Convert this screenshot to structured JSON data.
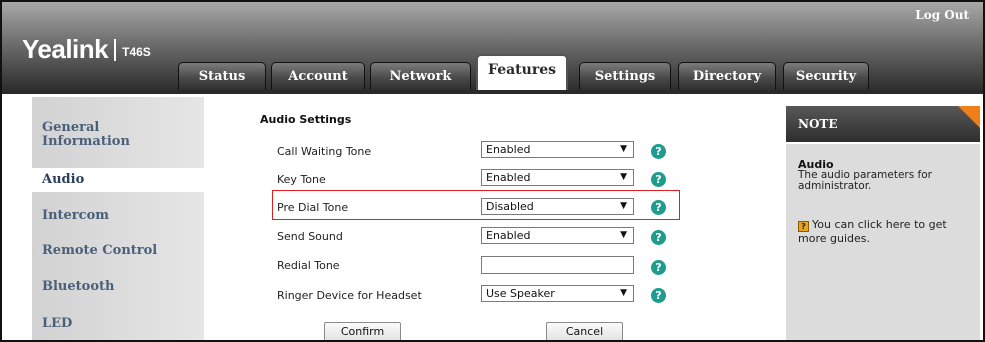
{
  "header": {
    "brand": "Yealink",
    "model": "T46S",
    "logout_label": "Log Out",
    "tabs": [
      {
        "label": "Status",
        "active": false
      },
      {
        "label": "Account",
        "active": false
      },
      {
        "label": "Network",
        "active": false
      },
      {
        "label": "Features",
        "active": true
      },
      {
        "label": "Settings",
        "active": false
      },
      {
        "label": "Directory",
        "active": false
      },
      {
        "label": "Security",
        "active": false
      }
    ]
  },
  "sidebar": {
    "items": [
      {
        "label": "General\nInformation",
        "active": false
      },
      {
        "label": "Audio",
        "active": true
      },
      {
        "label": "Intercom",
        "active": false
      },
      {
        "label": "Remote Control",
        "active": false
      },
      {
        "label": "Bluetooth",
        "active": false
      },
      {
        "label": "LED",
        "active": false
      }
    ]
  },
  "main": {
    "section_title": "Audio Settings",
    "rows": [
      {
        "label": "Call Waiting Tone",
        "type": "select",
        "value": "Enabled",
        "help": "?"
      },
      {
        "label": "Key Tone",
        "type": "select",
        "value": "Enabled",
        "help": "?"
      },
      {
        "label": "Pre Dial Tone",
        "type": "select",
        "value": "Disabled",
        "help": "?",
        "highlighted": true
      },
      {
        "label": "Send Sound",
        "type": "select",
        "value": "Enabled",
        "help": "?"
      },
      {
        "label": "Redial Tone",
        "type": "text",
        "value": "",
        "help": "?"
      },
      {
        "label": "Ringer Device for Headset",
        "type": "select",
        "value": "Use Speaker",
        "help": "?"
      }
    ],
    "confirm_label": "Confirm",
    "cancel_label": "Cancel"
  },
  "note": {
    "title": "NOTE",
    "heading": "Audio",
    "description": "The audio parameters for administrator.",
    "guide_text": "You can click here to get more guides.",
    "guide_icon": "?"
  },
  "colors": {
    "help_icon": "#1e9c8e",
    "highlight_border": "#e02020",
    "note_corner": "#f07f1a",
    "sidebar_text": "#4a5f7a"
  },
  "icons": {
    "help": "question-circle-icon",
    "select_arrow": "triangle-down-icon",
    "guide": "book-icon"
  }
}
